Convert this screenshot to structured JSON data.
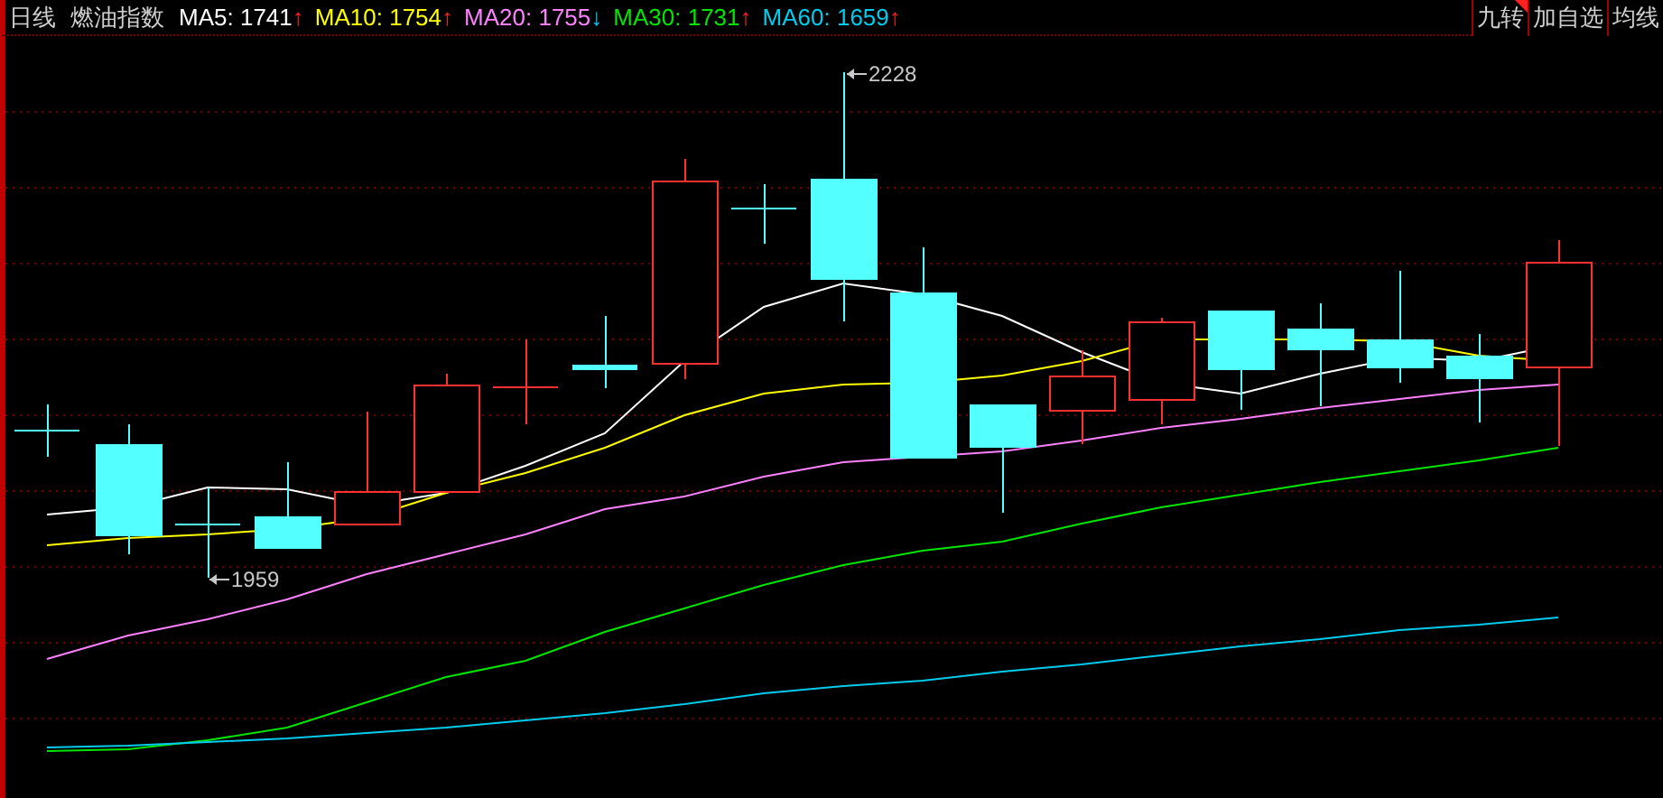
{
  "header": {
    "period": "日线",
    "title": "燃油指数",
    "moving_averages": [
      {
        "name": "MA5:",
        "value": "1741",
        "arrow": "↑",
        "kind": "up",
        "color": "#ffffff"
      },
      {
        "name": "MA10:",
        "value": "1754",
        "arrow": "↑",
        "kind": "up",
        "color": "#ffff00"
      },
      {
        "name": "MA20:",
        "value": "1755",
        "arrow": "↓",
        "kind": "down",
        "color": "#ff80ff"
      },
      {
        "name": "MA30:",
        "value": "1731",
        "arrow": "↑",
        "kind": "up",
        "color": "#00e600"
      },
      {
        "name": "MA60:",
        "value": "1659",
        "arrow": "↑",
        "kind": "up",
        "color": "#00ccee"
      }
    ],
    "buttons": [
      {
        "label": "九转",
        "flagged": true
      },
      {
        "label": "加自选",
        "flagged": false
      },
      {
        "label": "均线",
        "flagged": false
      }
    ]
  },
  "chart": {
    "high_label": "2228",
    "low_label": "1959"
  }
}
